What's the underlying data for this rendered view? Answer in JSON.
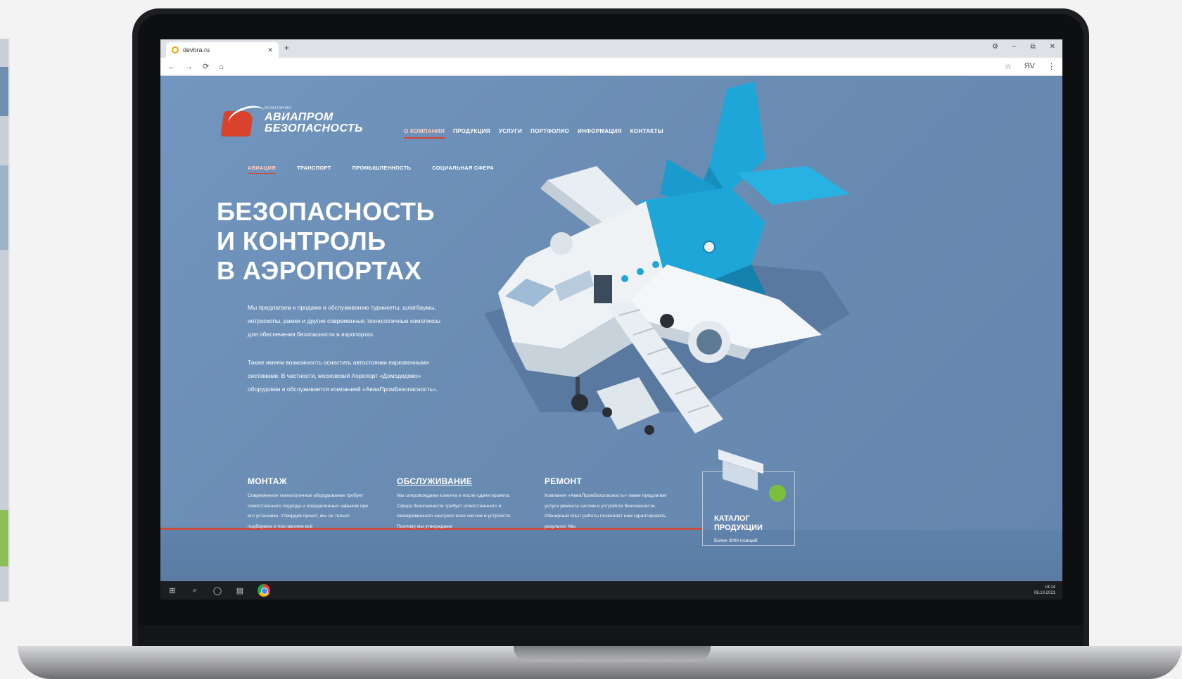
{
  "browser": {
    "tab_title": "devbra.ru",
    "tab_close": "✕",
    "new_tab": "+",
    "window_controls": [
      "⚙",
      "–",
      "⧉",
      "✕"
    ],
    "nav_buttons": [
      "←",
      "→",
      "⟳",
      "⌂"
    ],
    "addr_right": [
      "☆",
      "ЯV",
      "⋮"
    ]
  },
  "site": {
    "logo": {
      "small": "КОМПАНИЯ",
      "line1": "АВИАПРОМ",
      "line2": "БЕЗОПАСНОСТЬ"
    },
    "main_nav": [
      "О КОМПАНИИ",
      "ПРОДУКЦИЯ",
      "УСЛУГИ",
      "ПОРТФОЛИО",
      "ИНФОРМАЦИЯ",
      "КОНТАКТЫ"
    ],
    "sub_nav": [
      "АВИАЦИЯ",
      "ТРАНСПОРТ",
      "ПРОМЫШЛЕННОСТЬ",
      "СОЦИАЛЬНАЯ СФЕРА"
    ],
    "hero": {
      "title_l1": "БЕЗОПАСНОСТЬ",
      "title_l2": "И КОНТРОЛЬ",
      "title_l3": "В АЭРОПОРТАХ",
      "p1": "Мы предлагаем к продаже и обслуживанию турникеты, шлагбаумы, интроскопы, рамки и другие современные технологичные комплексы для обеспечения безопасности в аэропортах.",
      "p2": "Также имеем возможность оснастить автостоянки парковочными системами. В частности, московский Аэропорт «Домодедово» оборудован и обслуживается компанией «АвиаПромБезопасность»."
    },
    "columns": [
      {
        "title": "МОНТАЖ",
        "text": "Современное технологичное оборудование требует ответственного подхода и определенных навыков при его установке. Утвердив проект, мы не только подбираем и поставляем всё"
      },
      {
        "title": "ОБСЛУЖИВАНИЕ",
        "text": "Мы сопровождаем клиента и после сдачи проекта. Сфера безопасности требует ответственного и своевременного контроля всех систем и устройств. Поэтому мы утверждаем"
      },
      {
        "title": "РЕМОНТ",
        "text": "Компания «АвиаПромБезопасность» также предлагает услуги ремонта систем и устройств безопасности. Обширный опыт работы позволяет нам гарантировать результат. Мы"
      }
    ],
    "catalog": {
      "title": "КАТАЛОГ ПРОДУКЦИИ",
      "text": "Более 3000 позиций"
    }
  },
  "taskbar": {
    "icons": [
      "⊞",
      "⌕",
      "◯",
      "▤"
    ],
    "time": "16:14",
    "date": "08.10.2021"
  },
  "colors": {
    "page_bg": "#6a8db3",
    "accent_red": "#d9432d",
    "plane_blue": "#1fa6d8"
  }
}
